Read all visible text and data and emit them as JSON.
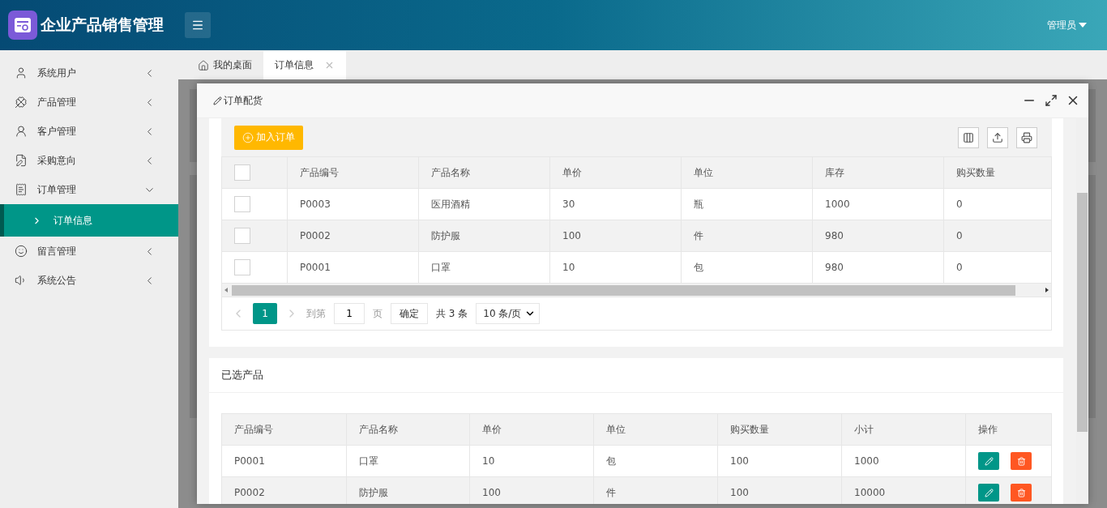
{
  "header": {
    "title": "企业产品销售管理",
    "user": "管理员"
  },
  "sidebar": {
    "items": [
      {
        "label": "系统用户",
        "expanded": false
      },
      {
        "label": "产品管理",
        "expanded": false
      },
      {
        "label": "客户管理",
        "expanded": false
      },
      {
        "label": "采购意向",
        "expanded": false
      },
      {
        "label": "订单管理",
        "expanded": true,
        "children": [
          {
            "label": "订单信息",
            "selected": true
          }
        ]
      },
      {
        "label": "留言管理",
        "expanded": false
      },
      {
        "label": "系统公告",
        "expanded": false
      }
    ]
  },
  "tabs": [
    {
      "label": "我的桌面",
      "kind": "home",
      "selected": false
    },
    {
      "label": "订单信息",
      "kind": "closable",
      "selected": true
    }
  ],
  "dialog": {
    "title": "订单配货",
    "products": {
      "add_button": "加入订单",
      "columns": [
        "产品编号",
        "产品名称",
        "单价",
        "单位",
        "库存",
        "购买数量"
      ],
      "rows": [
        {
          "checked": false,
          "cells": [
            "P0003",
            "医用酒精",
            "30",
            "瓶",
            "1000",
            "0"
          ]
        },
        {
          "checked": false,
          "cells": [
            "P0002",
            "防护服",
            "100",
            "件",
            "980",
            "0"
          ]
        },
        {
          "checked": false,
          "cells": [
            "P0001",
            "口罩",
            "10",
            "包",
            "980",
            "0"
          ]
        }
      ],
      "header_checked": false,
      "pagination": {
        "pages": [
          {
            "label": "1",
            "selected": true
          }
        ],
        "goto_label": "到第",
        "goto_value": "1",
        "page_unit": "页",
        "confirm": "确定",
        "total": "共 3 条",
        "page_size": "10 条/页"
      }
    },
    "selected": {
      "title": "已选产品",
      "columns": [
        "产品编号",
        "产品名称",
        "单价",
        "单位",
        "购买数量",
        "小计",
        "操作"
      ],
      "rows": [
        {
          "cells": [
            "P0001",
            "口罩",
            "10",
            "包",
            "100",
            "1000"
          ]
        },
        {
          "cells": [
            "P0002",
            "防护服",
            "100",
            "件",
            "100",
            "10000"
          ]
        }
      ]
    }
  }
}
